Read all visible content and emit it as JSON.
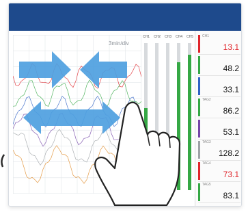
{
  "window": {
    "accent_color": "#1e4a8c",
    "background": "#ffffff"
  },
  "plot": {
    "corner_label": "3min/div",
    "gesture_icons": [
      "pinch-in-arrows-icon",
      "spread-arrows-icon",
      "pointing-hand-icon"
    ]
  },
  "bar_channels": [
    {
      "head": "CH1",
      "level": 0.56,
      "color": "#35a845"
    },
    {
      "head": "CH2",
      "level": 0.34,
      "color": "#7446a8"
    },
    {
      "head": "CH3",
      "level": 0.18,
      "color": "#9ea2a6"
    },
    {
      "head": "CH4",
      "level": 0.87,
      "color": "#35a845"
    },
    {
      "head": "CH5",
      "level": 0.92,
      "color": "#35a845"
    }
  ],
  "panel_tiles": [
    {
      "tag": "CH1",
      "value": "13.1",
      "color": "#e0262c",
      "stripe": "#e0262c"
    },
    {
      "tag": "",
      "value": "48.2",
      "color": "#111111",
      "stripe": "#35a845"
    },
    {
      "tag": "",
      "value": "33.1",
      "color": "#111111",
      "stripe": "#2f62c5"
    },
    {
      "tag": "TAG2",
      "value": "86.2",
      "color": "#111111",
      "stripe": "#35a845"
    },
    {
      "tag": "",
      "value": "53.1",
      "color": "#111111",
      "stripe": "#7446a8"
    },
    {
      "tag": "TAG3",
      "value": "128.2",
      "color": "#111111",
      "stripe": "#9ea2a6"
    },
    {
      "tag": "TAG4",
      "value": "73.1",
      "color": "#e0262c",
      "stripe": "#e0262c"
    },
    {
      "tag": "TAG5",
      "value": "83.1",
      "color": "#111111",
      "stripe": "#35a845"
    }
  ]
}
